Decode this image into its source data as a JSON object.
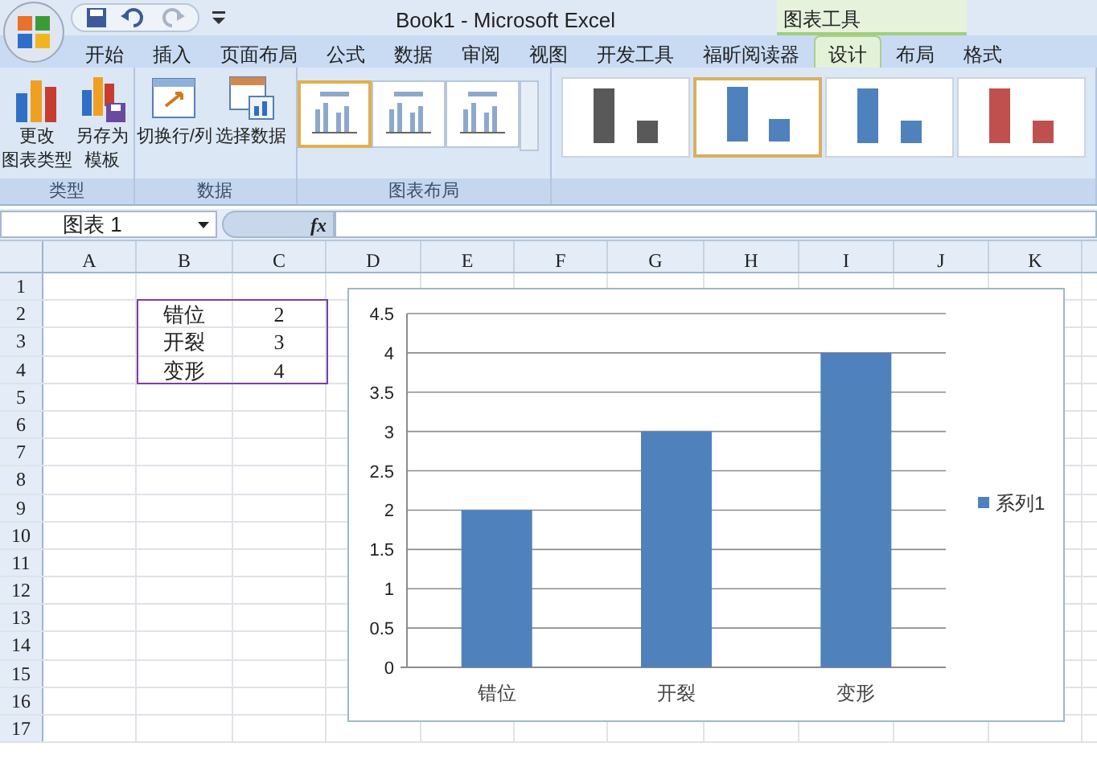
{
  "window": {
    "title": "Book1 - Microsoft Excel"
  },
  "contextual_tab_group": "图表工具",
  "tabs": [
    {
      "label": "开始",
      "selected": false
    },
    {
      "label": "插入",
      "selected": false
    },
    {
      "label": "页面布局",
      "selected": false
    },
    {
      "label": "公式",
      "selected": false
    },
    {
      "label": "数据",
      "selected": false
    },
    {
      "label": "审阅",
      "selected": false
    },
    {
      "label": "视图",
      "selected": false
    },
    {
      "label": "开发工具",
      "selected": false
    },
    {
      "label": "福昕阅读器",
      "selected": false
    },
    {
      "label": "设计",
      "selected": true
    },
    {
      "label": "布局",
      "selected": false
    },
    {
      "label": "格式",
      "selected": false
    }
  ],
  "ribbon_groups": [
    {
      "label": "类型",
      "buttons": [
        {
          "kind": "change-type",
          "lines": [
            "更改",
            "图表类型"
          ]
        },
        {
          "kind": "save-template",
          "lines": [
            "另存为",
            "模板"
          ]
        }
      ]
    },
    {
      "label": "数据",
      "buttons": [
        {
          "kind": "switch",
          "lines": [
            "切换行/列"
          ]
        },
        {
          "kind": "select-data",
          "lines": [
            "选择数据"
          ]
        }
      ]
    },
    {
      "label": "图表布局",
      "layouts": [
        {
          "selected": true
        },
        {
          "selected": false
        },
        {
          "selected": false
        }
      ]
    },
    {
      "styles": [
        {
          "color": "#595959",
          "selected": false
        },
        {
          "color": "#4f81bd",
          "selected": true
        },
        {
          "color": "#4f81bd",
          "selected": false
        },
        {
          "color": "#c0504d",
          "selected": false
        }
      ]
    }
  ],
  "name_box": "图表 1",
  "formula_label": "fx",
  "columns": [
    "A",
    "B",
    "C",
    "D",
    "E",
    "F",
    "G",
    "H",
    "I",
    "J",
    "K"
  ],
  "rows": [
    "1",
    "2",
    "3",
    "4",
    "5",
    "6",
    "7",
    "8",
    "9",
    "10",
    "11",
    "12",
    "13",
    "14",
    "15",
    "16",
    "17"
  ],
  "data_range": [
    [
      "错位",
      "2"
    ],
    [
      "开裂",
      "3"
    ],
    [
      "变形",
      "4"
    ]
  ],
  "chart": {
    "chart_data": {
      "type": "bar",
      "categories": [
        "错位",
        "开裂",
        "变形"
      ],
      "series": [
        {
          "name": "系列1",
          "color": "#4f81bd",
          "values": [
            2,
            3,
            4
          ]
        }
      ],
      "grid": {
        "y": true
      },
      "ylim": [
        0,
        4.5
      ],
      "yticks": [
        0,
        0.5,
        1,
        1.5,
        2,
        2.5,
        3,
        3.5,
        4,
        4.5
      ]
    }
  }
}
